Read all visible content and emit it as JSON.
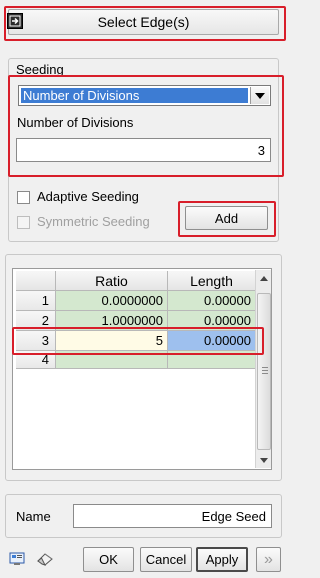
{
  "header": {
    "title": "Select Edge(s)",
    "icon": "select-edge-icon"
  },
  "seeding": {
    "group_label": "Seeding",
    "method": {
      "selected": "Number of Divisions"
    },
    "divisions_label": "Number of Divisions",
    "divisions_value": "3",
    "adaptive_label": "Adaptive Seeding",
    "adaptive_checked": false,
    "symmetric_label": "Symmetric Seeding",
    "symmetric_enabled": false,
    "add_label": "Add"
  },
  "table": {
    "columns": [
      "Ratio",
      "Length"
    ],
    "rows": [
      {
        "index": "1",
        "ratio": "0.0000000",
        "length": "0.00000"
      },
      {
        "index": "2",
        "ratio": "1.0000000",
        "length": "0.00000"
      },
      {
        "index": "3",
        "ratio": "5",
        "length": "0.00000"
      },
      {
        "index": "4",
        "ratio": "",
        "length": ""
      }
    ],
    "active_row": 3
  },
  "name": {
    "label": "Name",
    "value": "Edge Seed"
  },
  "footer": {
    "ok_label": "OK",
    "cancel_label": "Cancel",
    "apply_label": "Apply",
    "more_label": "»",
    "left_icons": [
      "preview-icon",
      "eraser-icon"
    ]
  },
  "colors": {
    "highlight_box": "#d81e2a",
    "selection_blue": "#3d7cd3",
    "green_cells": "#d4e8cf",
    "edit_cell": "#fffbe6",
    "length_active": "#9ec0ee"
  }
}
